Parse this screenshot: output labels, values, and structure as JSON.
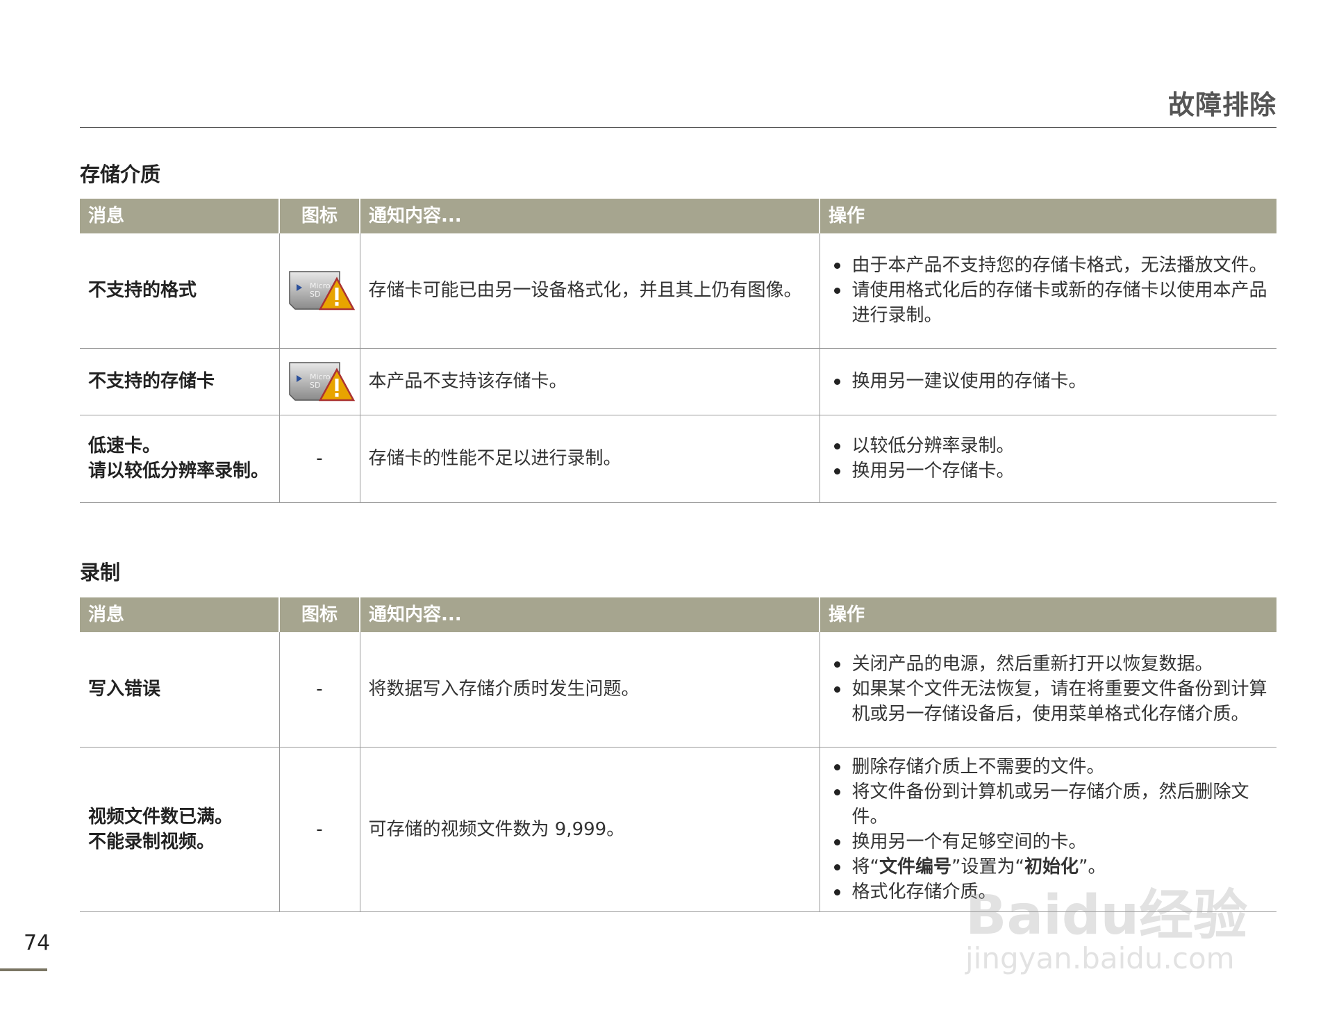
{
  "header": {
    "title": "故障排除"
  },
  "sections": [
    {
      "title": "存储介质",
      "columns": {
        "message": "消息",
        "icon": "图标",
        "content": "通知内容...",
        "action": "操作"
      },
      "rows": [
        {
          "message": "不支持的格式",
          "icon": "microsd-warning-icon",
          "icon_label": "Micro SD",
          "content": "存储卡可能已由另一设备格式化，并且其上仍有图像。",
          "actions": [
            "由于本产品不支持您的存储卡格式，无法播放文件。",
            "请使用格式化后的存储卡或新的存储卡以使用本产品进行录制。"
          ]
        },
        {
          "message": "不支持的存储卡",
          "icon": "microsd-warning-icon",
          "icon_label": "Micro SD",
          "content": "本产品不支持该存储卡。",
          "actions": [
            "换用另一建议使用的存储卡。"
          ]
        },
        {
          "message": "低速卡。\n请以较低分辨率录制。",
          "icon_text": "-",
          "content": "存储卡的性能不足以进行录制。",
          "actions": [
            "以较低分辨率录制。",
            "换用另一个存储卡。"
          ]
        }
      ]
    },
    {
      "title": "录制",
      "columns": {
        "message": "消息",
        "icon": "图标",
        "content": "通知内容...",
        "action": "操作"
      },
      "rows": [
        {
          "message": "写入错误",
          "icon_text": "-",
          "content": "将数据写入存储介质时发生问题。",
          "actions": [
            "关闭产品的电源，然后重新打开以恢复数据。",
            "如果某个文件无法恢复，请在将重要文件备份到计算机或另一存储设备后，使用菜单格式化存储介质。"
          ]
        },
        {
          "message": "视频文件数已满。\n不能录制视频。",
          "icon_text": "-",
          "content": "可存储的视频文件数为 9,999。",
          "actions": [
            "删除存储介质上不需要的文件。",
            "将文件备份到计算机或另一存储介质，然后删除文件。",
            "换用另一个有足够空间的卡。"
          ],
          "action_rich": {
            "prefix": "将“",
            "bold1": "文件编号",
            "middle": "”设置为“",
            "bold2": "初始化",
            "suffix": "”。"
          },
          "action_last": "格式化存储介质。"
        }
      ]
    }
  ],
  "page_number": "74",
  "watermark": {
    "top": "Baidu经验",
    "bottom": "jingyan.baidu.com"
  },
  "colors": {
    "header_bg": "#a6a58f",
    "rule": "#555555",
    "warning": "#e8a400"
  }
}
